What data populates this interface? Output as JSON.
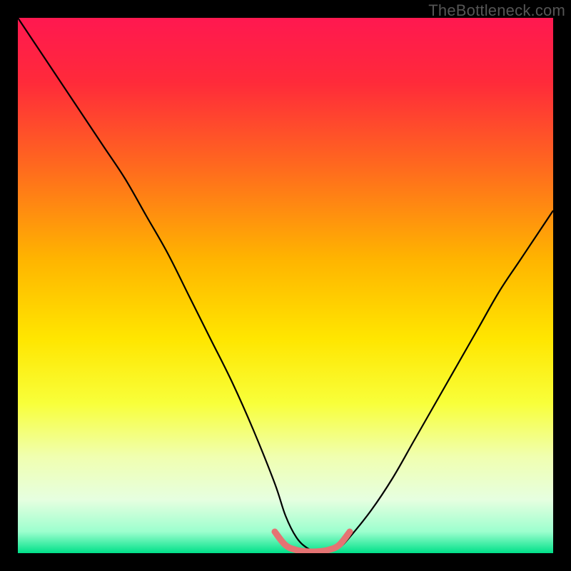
{
  "watermark": "TheBottleneck.com",
  "chart_data": {
    "type": "line",
    "title": "",
    "xlabel": "",
    "ylabel": "",
    "xlim": [
      0,
      100
    ],
    "ylim": [
      0,
      100
    ],
    "gradient_stops": [
      {
        "offset": 0.0,
        "color": "#ff1850"
      },
      {
        "offset": 0.12,
        "color": "#ff2a3a"
      },
      {
        "offset": 0.28,
        "color": "#ff6a1e"
      },
      {
        "offset": 0.45,
        "color": "#ffb400"
      },
      {
        "offset": 0.6,
        "color": "#ffe600"
      },
      {
        "offset": 0.72,
        "color": "#f8ff3a"
      },
      {
        "offset": 0.82,
        "color": "#f0ffb0"
      },
      {
        "offset": 0.9,
        "color": "#e6ffe0"
      },
      {
        "offset": 0.96,
        "color": "#9cffce"
      },
      {
        "offset": 1.0,
        "color": "#00e089"
      }
    ],
    "series": [
      {
        "name": "bottleneck-curve",
        "x": [
          0,
          4,
          8,
          12,
          16,
          20,
          24,
          28,
          32,
          36,
          40,
          44,
          48,
          50,
          52,
          54,
          56,
          58,
          60,
          62,
          66,
          70,
          74,
          78,
          82,
          86,
          90,
          94,
          98,
          100
        ],
        "y": [
          100,
          94,
          88,
          82,
          76,
          70,
          63,
          56,
          48,
          40,
          32,
          23,
          13,
          7,
          3,
          1,
          0.3,
          0.3,
          1,
          3,
          8,
          14,
          21,
          28,
          35,
          42,
          49,
          55,
          61,
          64
        ]
      },
      {
        "name": "optimal-band-marker",
        "x": [
          48,
          50,
          52,
          54,
          56,
          58,
          60,
          62
        ],
        "y": [
          4,
          1.5,
          0.6,
          0.3,
          0.3,
          0.6,
          1.5,
          4
        ]
      }
    ]
  }
}
